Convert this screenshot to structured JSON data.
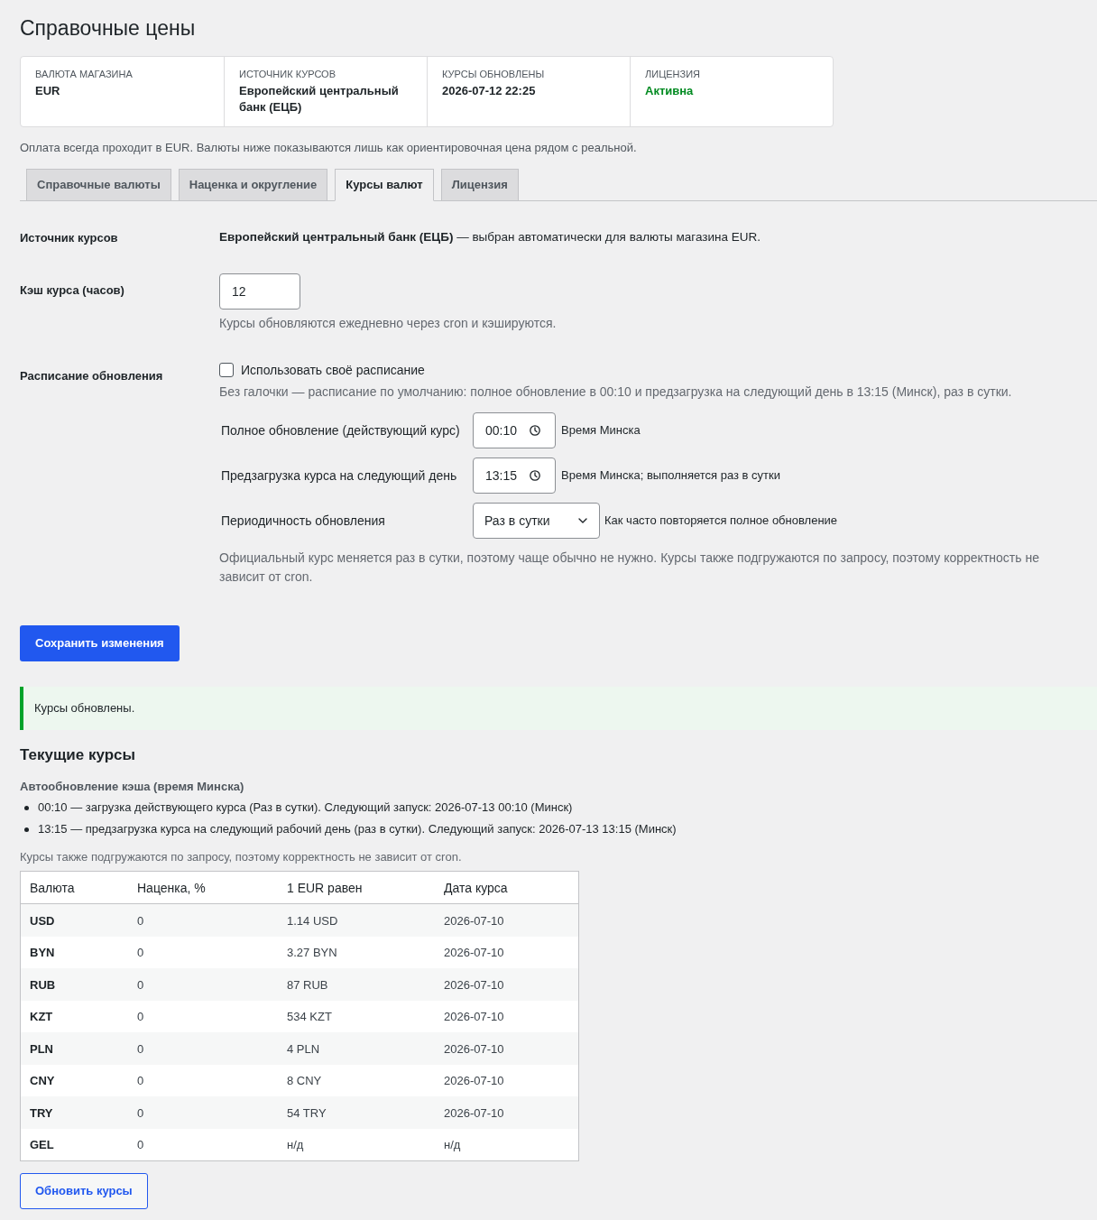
{
  "page": {
    "title": "Справочные цены"
  },
  "summary": [
    {
      "label": "ВАЛЮТА МАГАЗИНА",
      "value": "EUR",
      "kind": "text"
    },
    {
      "label": "ИСТОЧНИК КУРСОВ",
      "value": "Европейский центральный банк (ЕЦБ)",
      "kind": "text"
    },
    {
      "label": "КУРСЫ ОБНОВЛЕНЫ",
      "value": "2026-07-12 22:25",
      "kind": "text"
    },
    {
      "label": "ЛИЦЕНЗИЯ",
      "value": "Активна",
      "kind": "status"
    }
  ],
  "payment_note": "Оплата всегда проходит в EUR. Валюты ниже показываются лишь как ориентировочная цена рядом с реальной.",
  "tabs": [
    {
      "label": "Справочные валюты",
      "selected": false
    },
    {
      "label": "Наценка и округление",
      "selected": false
    },
    {
      "label": "Курсы валют",
      "selected": true
    },
    {
      "label": "Лицензия",
      "selected": false
    }
  ],
  "settings": {
    "source": {
      "label": "Источник курсов",
      "value": "**Европейский центральный банк (ЕЦБ)** — выбран автоматически для валюты магазина EUR."
    },
    "cache": {
      "label": "Кэш курса (часов)",
      "value": "12",
      "description": "Курсы обновляются ежедневно через cron и кэшируются."
    },
    "schedule": {
      "label": "Расписание обновления",
      "checkbox": {
        "label": "Использовать своё расписание",
        "checked": false
      },
      "description": "Без галочки — расписание по умолчанию: полное обновление в 00:10 и предзагрузка на следующий день в 13:15 (Минск), раз в сутки.",
      "fields": [
        {
          "kind": "time",
          "label": "Полное обновление (действующий курс)",
          "value": "00:10",
          "hint": "Время Минска"
        },
        {
          "kind": "time",
          "label": "Предзагрузка курса на следующий день",
          "value": "13:15",
          "hint": "Время Минска; выполняется раз в сутки"
        },
        {
          "kind": "select",
          "label": "Периодичность обновления",
          "value": "Раз в сутки",
          "hint": "Как часто повторяется полное обновление"
        }
      ],
      "footnote": "Официальный курс меняется раз в сутки, поэтому чаще обычно не нужно. Курсы также подгружаются по запросу, поэтому корректность не зависит от cron."
    }
  },
  "save_button": "Сохранить изменения",
  "success_notice": "Курсы обновлены.",
  "current_rates": {
    "title": "Текущие курсы",
    "schedule_title": "Автообновление кэша (время Минска)",
    "schedule_items": [
      "00:10 — загрузка действующего курса (Раз в сутки). Следующий запуск: 2026-07-13 00:10 (Минск)",
      "13:15 — предзагрузка курса на следующий рабочий день (раз в сутки). Следующий запуск: 2026-07-13 13:15 (Минск)"
    ],
    "note": "Курсы также подгружаются по запросу, поэтому корректность не зависит от cron.",
    "table": {
      "columns": [
        "Валюта",
        "Наценка, %",
        "1 EUR равен",
        "Дата курса"
      ],
      "rows": [
        [
          "USD",
          "0",
          "1.14 USD",
          "2026-07-10"
        ],
        [
          "BYN",
          "0",
          "3.27 BYN",
          "2026-07-10"
        ],
        [
          "RUB",
          "0",
          "87 RUB",
          "2026-07-10"
        ],
        [
          "KZT",
          "0",
          "534 KZT",
          "2026-07-10"
        ],
        [
          "PLN",
          "0",
          "4 PLN",
          "2026-07-10"
        ],
        [
          "CNY",
          "0",
          "8 CNY",
          "2026-07-10"
        ],
        [
          "TRY",
          "0",
          "54 TRY",
          "2026-07-10"
        ],
        [
          "GEL",
          "0",
          "н/д",
          "н/д"
        ]
      ]
    }
  },
  "refresh_button": "Обновить курсы"
}
